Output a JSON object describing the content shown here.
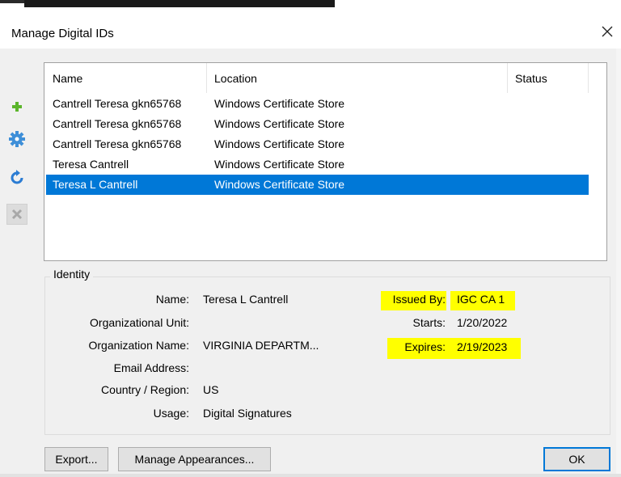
{
  "dialog": {
    "title": "Manage Digital IDs"
  },
  "list": {
    "columns": [
      "Name",
      "Location",
      "Status"
    ],
    "rows": [
      {
        "name": "Cantrell Teresa gkn65768",
        "location": "Windows Certificate Store",
        "status": ""
      },
      {
        "name": "Cantrell Teresa gkn65768",
        "location": "Windows Certificate Store",
        "status": ""
      },
      {
        "name": "Cantrell Teresa gkn65768",
        "location": "Windows Certificate Store",
        "status": ""
      },
      {
        "name": "Teresa Cantrell",
        "location": "Windows Certificate Store",
        "status": ""
      },
      {
        "name": "Teresa L Cantrell",
        "location": "Windows Certificate Store",
        "status": ""
      }
    ],
    "selected_index": 4
  },
  "identity": {
    "legend": "Identity",
    "fields": {
      "name": {
        "label": "Name:",
        "value": "Teresa L Cantrell"
      },
      "org_unit": {
        "label": "Organizational Unit:",
        "value": ""
      },
      "org_name": {
        "label": "Organization Name:",
        "value": "VIRGINIA DEPARTM..."
      },
      "email": {
        "label": "Email Address:",
        "value": ""
      },
      "country": {
        "label": "Country / Region:",
        "value": "US"
      },
      "usage": {
        "label": "Usage:",
        "value": "Digital Signatures"
      },
      "issued_by": {
        "label": "Issued By:",
        "value": "IGC CA 1"
      },
      "starts": {
        "label": "Starts:",
        "value": "1/20/2022"
      },
      "expires": {
        "label": "Expires:",
        "value": "2/19/2023"
      }
    },
    "highlight_color": "#ffff00"
  },
  "buttons": {
    "export": "Export...",
    "manage_appearances": "Manage Appearances...",
    "ok": "OK"
  },
  "toolbar": [
    "add-icon",
    "gear-icon",
    "refresh-icon",
    "remove-icon"
  ],
  "colors": {
    "selection": "#0078d7",
    "panel": "#f0f0f0"
  }
}
